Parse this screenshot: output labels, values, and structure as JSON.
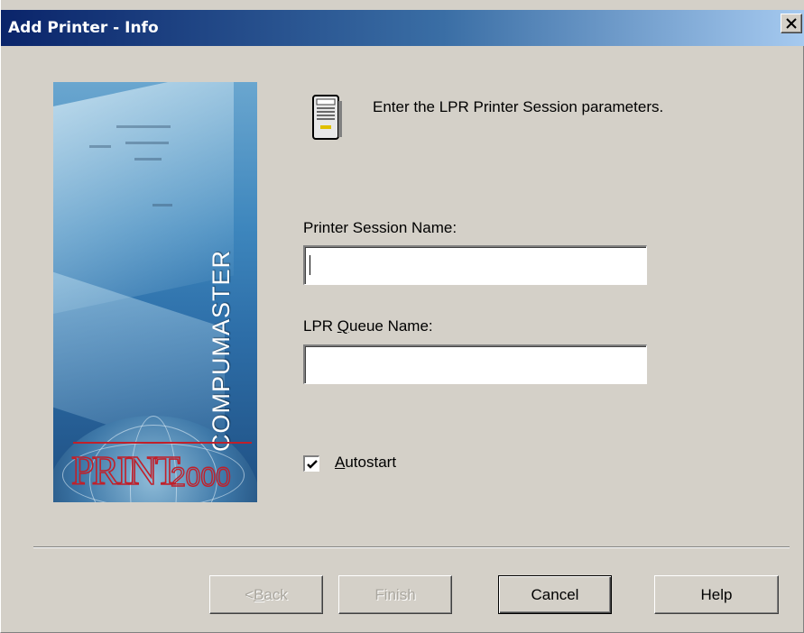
{
  "window": {
    "title": "Add Printer - Info",
    "close_symbol": "✕"
  },
  "banner": {
    "brand_text": "COMPUMASTER",
    "logo_text_primary": "PRINT",
    "logo_text_secondary": "2000"
  },
  "header": {
    "icon": "printer-icon",
    "instruction": "Enter the LPR Printer Session parameters."
  },
  "form": {
    "session_name_label": "Printer Session Name:",
    "session_name_value": "",
    "queue_name_label_pre": "LPR ",
    "queue_name_label_mnemonic": "Q",
    "queue_name_label_post": "ueue Name:",
    "queue_name_value": "",
    "autostart_mnemonic": "A",
    "autostart_rest": "utostart",
    "autostart_checked": true
  },
  "buttons": {
    "back_pre": "< ",
    "back_mnemonic": "B",
    "back_post": "ack",
    "finish": "Finish",
    "cancel": "Cancel",
    "help": "Help"
  },
  "colors": {
    "titlebar_start": "#0a246a",
    "titlebar_end": "#a6caf0",
    "dialog_bg": "#d4d0c8",
    "logo_red": "#c0202a"
  }
}
